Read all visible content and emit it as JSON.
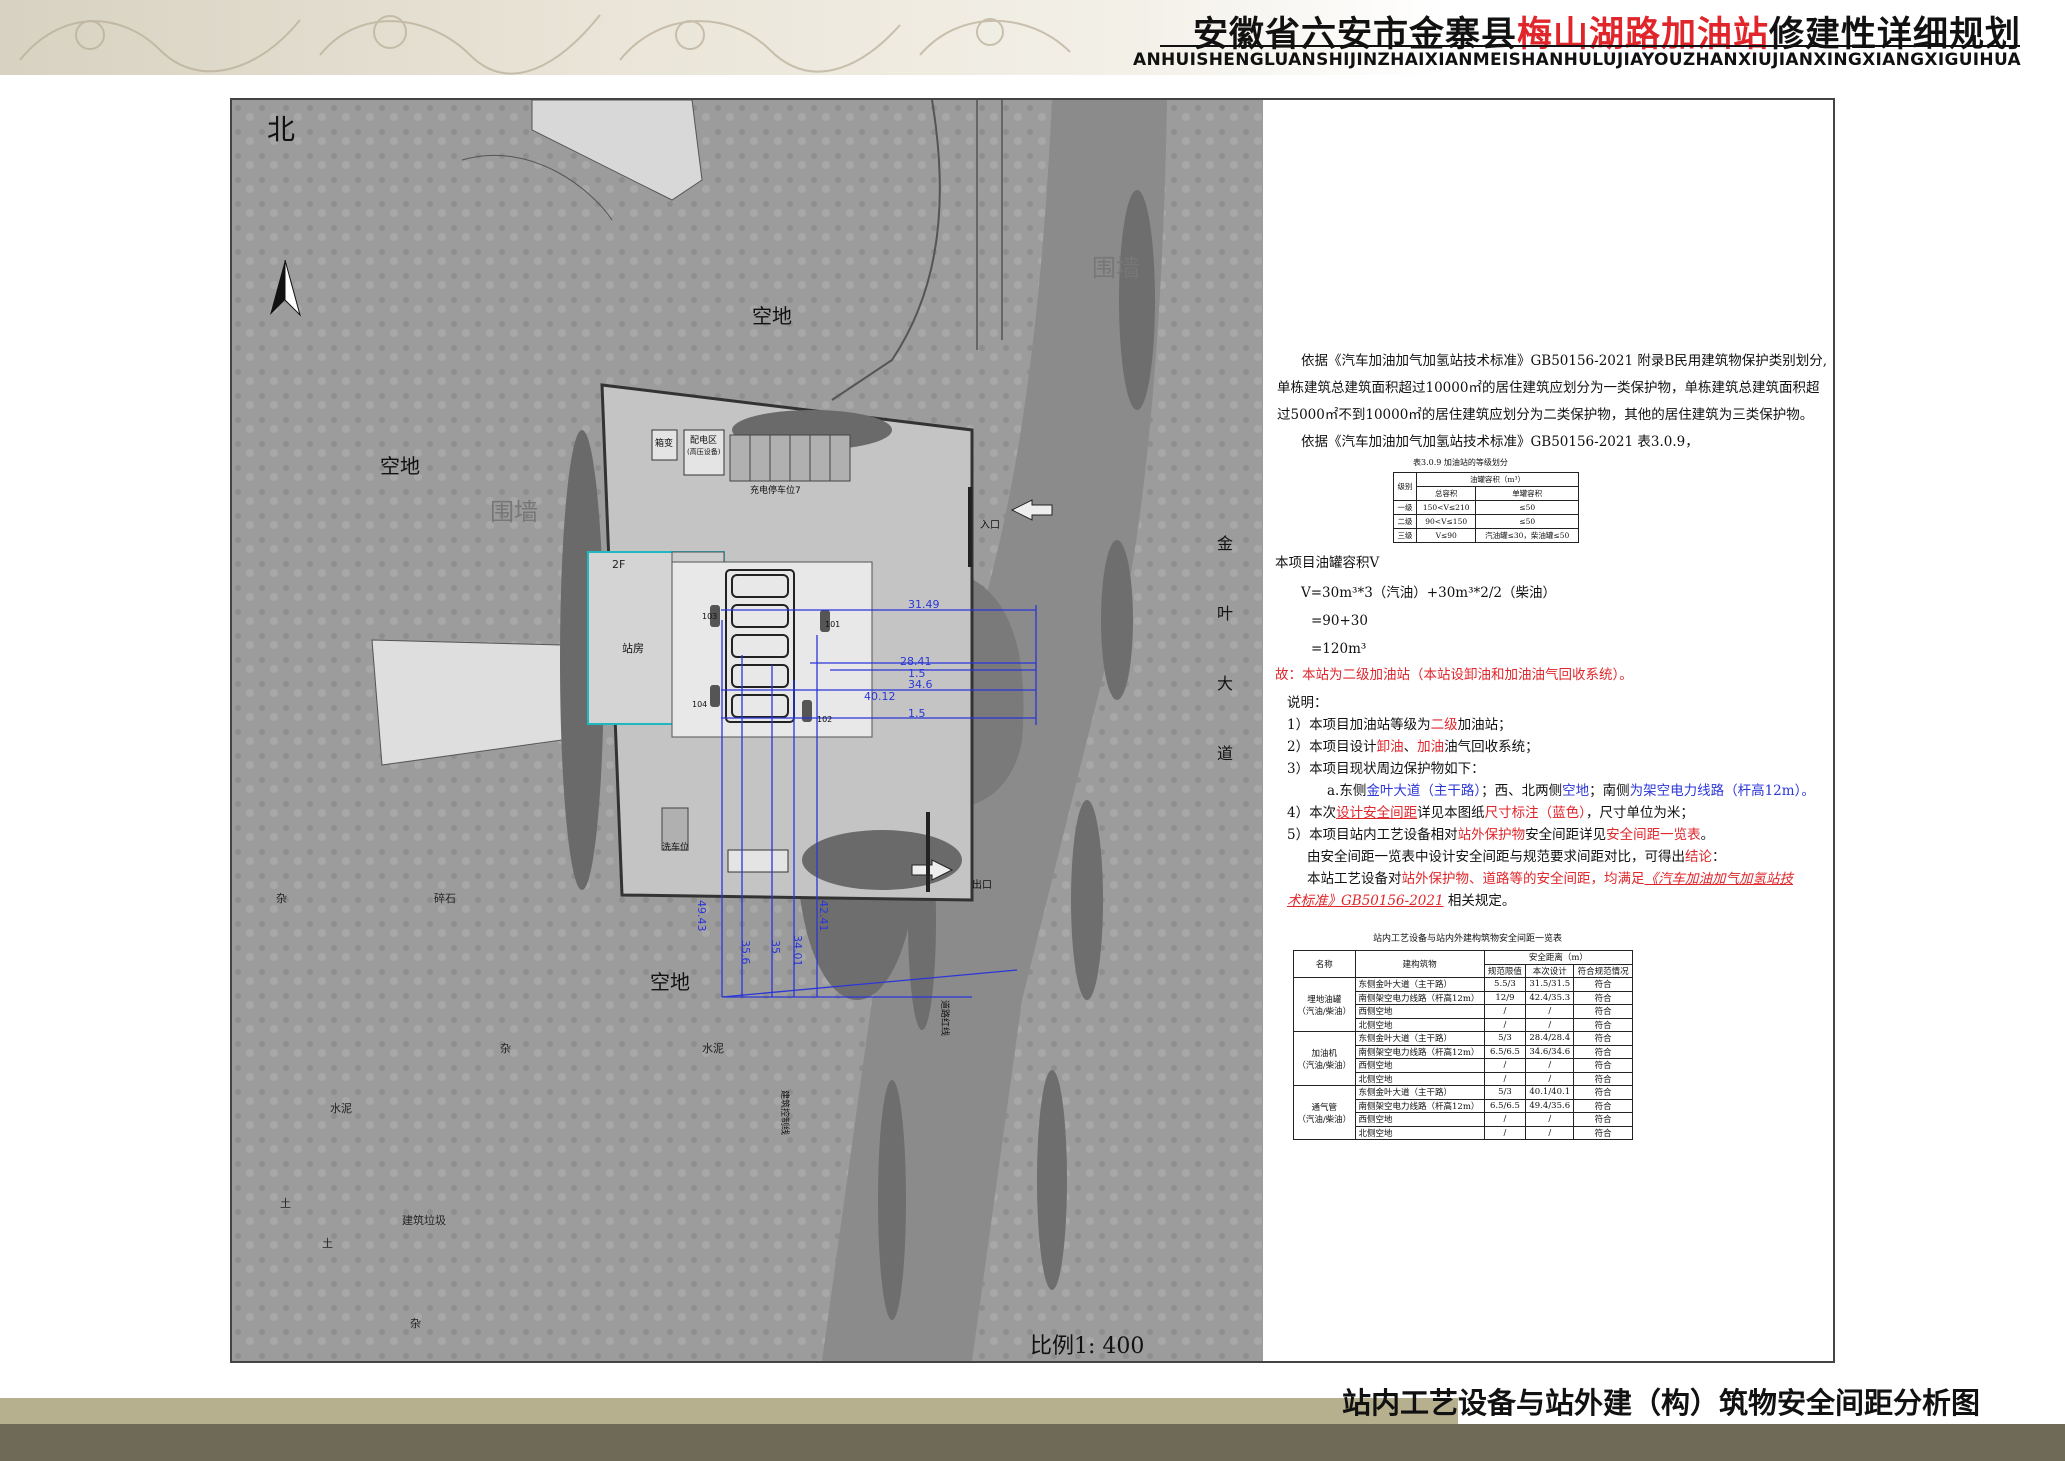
{
  "header": {
    "title_prefix": "安徽省六安市金寨县",
    "title_highlight": "梅山湖路加油站",
    "title_suffix": "修建性详细规划",
    "pinyin": "ANHUISHENGLUANSHIJINZHAIXIANMEISHANHULUJIAYOUZHANXIUJIANXINGXIANGXIGUIHUA"
  },
  "colors": {
    "red": "#e0262b",
    "blue": "#2b36d8",
    "band_olive": "#b6b08e",
    "band_dark": "#6e6a57"
  },
  "plan": {
    "north": "北",
    "labels": {
      "empty_1": "空地",
      "empty_2": "空地",
      "empty_3": "空地",
      "wall_1": "围墙",
      "wall_2": "围墙",
      "gravel": "碎石",
      "cement_1": "水泥",
      "cement_2": "水泥",
      "building_site": "建筑垃圾",
      "misc_1": "杂",
      "misc_2": "杂",
      "misc_3": "杂",
      "soil_1": "土",
      "soil_2": "土",
      "station_house": "站房",
      "floor": "2F",
      "box_substation": "箱变",
      "distribution": "配电区",
      "distribution_sub": "(高压设备)",
      "charge_parking": "充电停车位7",
      "wash": "洗车位",
      "entry": "入口",
      "exit": "出口",
      "road_v1": "金",
      "road_v2": "叶",
      "road_v3": "大",
      "road_v4": "道",
      "dispenser_101": "101",
      "dispenser_102": "102",
      "dispenser_103": "103",
      "dispenser_104": "104",
      "build_line": "建筑控制线",
      "road_line": "道路红线"
    },
    "dimensions": [
      "31.49",
      "28.41",
      "34.6",
      "40.12",
      "49.43",
      "35.6",
      "35",
      "34.01",
      "42.41",
      "1.5",
      "1.5"
    ],
    "scale": "比例1: 400"
  },
  "notes": {
    "para1": "依据《汽车加油加气加氢站技术标准》GB50156-2021 附录B民用建筑物保护类别划分,",
    "para1b": "单栋建筑总建筑面积超过10000㎡的居住建筑应划分为一类保护物，单栋建筑总建筑面积超",
    "para1c": "过5000㎡不到10000㎡的居住建筑应划分为二类保护物，其他的居住建筑为三类保护物。",
    "para2": "依据《汽车加油加气加氢站技术标准》GB50156-2021 表3.0.9，",
    "grade_table_title": "表3.0.9 加油站的等级划分",
    "grade_headers": {
      "level": "级别",
      "volume": "油罐容积（m³）",
      "total": "总容积",
      "single": "单罐容积"
    },
    "grade_rows": [
      {
        "level": "一级",
        "total": "150<V≤210",
        "single": "≤50"
      },
      {
        "level": "二级",
        "total": "90<V≤150",
        "single": "≤50"
      },
      {
        "level": "三级",
        "total": "V≤90",
        "single": "汽油罐≤30，柴油罐≤50"
      }
    ],
    "tank_title": "本项目油罐容积V",
    "formula_1": "V=30m³*3（汽油）+30m³*2/2（柴油）",
    "formula_2": "=90+30",
    "formula_3": "=120m³",
    "conclusion_prefix": "故：",
    "conclusion": "本站为二级加油站（本站设卸油和加油油气回收系统）。",
    "explain_title": "说明：",
    "item1_a": "1）本项目加油站等级为",
    "item1_b": "二级",
    "item1_c": "加油站；",
    "item2_a": "2）本项目设计",
    "item2_b": "卸油",
    "item2_c": "、",
    "item2_d": "加油",
    "item2_e": "油气回收系统；",
    "item3": "3）本项目现状周边保护物如下：",
    "item3a_a": "a.东侧",
    "item3a_b": "金叶大道（主干路）",
    "item3a_c": "；西、北两侧",
    "item3a_d": "空地",
    "item3a_e": "；南侧",
    "item3a_f": "为架空电力线路（杆高12m）。",
    "item4_a": "4）本次",
    "item4_b": "设计安全间距",
    "item4_c": "详见本图纸",
    "item4_d": "尺寸标注（蓝色）",
    "item4_e": "，尺寸单位为米；",
    "item5_a": "5）本项目站内工艺设备相对",
    "item5_b": "站外保护物",
    "item5_c": "安全间距详见",
    "item5_d": "安全间距一览表",
    "item5_e": "。",
    "item6_a": "由安全间距一览表中设计安全间距与规范要求间距对比，可得出",
    "item6_b": "结论",
    "item6_c": "：",
    "item7_a": "本站工艺设备对",
    "item7_b": "站外保护物、道路等的安全间距，均满足",
    "item7_c": "《汽车加油加气加氢站技",
    "item8_a": "术标准》GB50156-2021",
    "item8_b": " 相关规定。"
  },
  "dist_table": {
    "title": "站内工艺设备与站内外建构筑物安全间距一览表",
    "h_name": "名称",
    "h_building": "建构筑物",
    "h_distance": "安全距离（m）",
    "h_spec": "规范限值",
    "h_design": "本次设计",
    "h_ok": "符合规范情况",
    "groups": [
      {
        "name": "埋地油罐",
        "sub": "（汽油/柴油）",
        "rows": [
          {
            "building": "东侧金叶大道（主干路）",
            "spec": "5.5/3",
            "design": "31.5/31.5",
            "ok": "符合"
          },
          {
            "building": "南侧架空电力线路（杆高12m）",
            "spec": "12/9",
            "design": "42.4/35.3",
            "ok": "符合"
          },
          {
            "building": "西侧空地",
            "spec": "/",
            "design": "/",
            "ok": "符合"
          },
          {
            "building": "北侧空地",
            "spec": "/",
            "design": "/",
            "ok": "符合"
          }
        ]
      },
      {
        "name": "加油机",
        "sub": "（汽油/柴油）",
        "rows": [
          {
            "building": "东侧金叶大道（主干路）",
            "spec": "5/3",
            "design": "28.4/28.4",
            "ok": "符合"
          },
          {
            "building": "南侧架空电力线路（杆高12m）",
            "spec": "6.5/6.5",
            "design": "34.6/34.6",
            "ok": "符合"
          },
          {
            "building": "西侧空地",
            "spec": "/",
            "design": "/",
            "ok": "符合"
          },
          {
            "building": "北侧空地",
            "spec": "/",
            "design": "/",
            "ok": "符合"
          }
        ]
      },
      {
        "name": "通气管",
        "sub": "（汽油/柴油）",
        "rows": [
          {
            "building": "东侧金叶大道（主干路）",
            "spec": "5/3",
            "design": "40.1/40.1",
            "ok": "符合"
          },
          {
            "building": "南侧架空电力线路（杆高12m）",
            "spec": "6.5/6.5",
            "design": "49.4/35.6",
            "ok": "符合"
          },
          {
            "building": "西侧空地",
            "spec": "/",
            "design": "/",
            "ok": "符合"
          },
          {
            "building": "北侧空地",
            "spec": "/",
            "design": "/",
            "ok": "符合"
          }
        ]
      }
    ]
  },
  "footer": {
    "drawing_title": "站内工艺设备与站外建（构）筑物安全间距分析图"
  }
}
